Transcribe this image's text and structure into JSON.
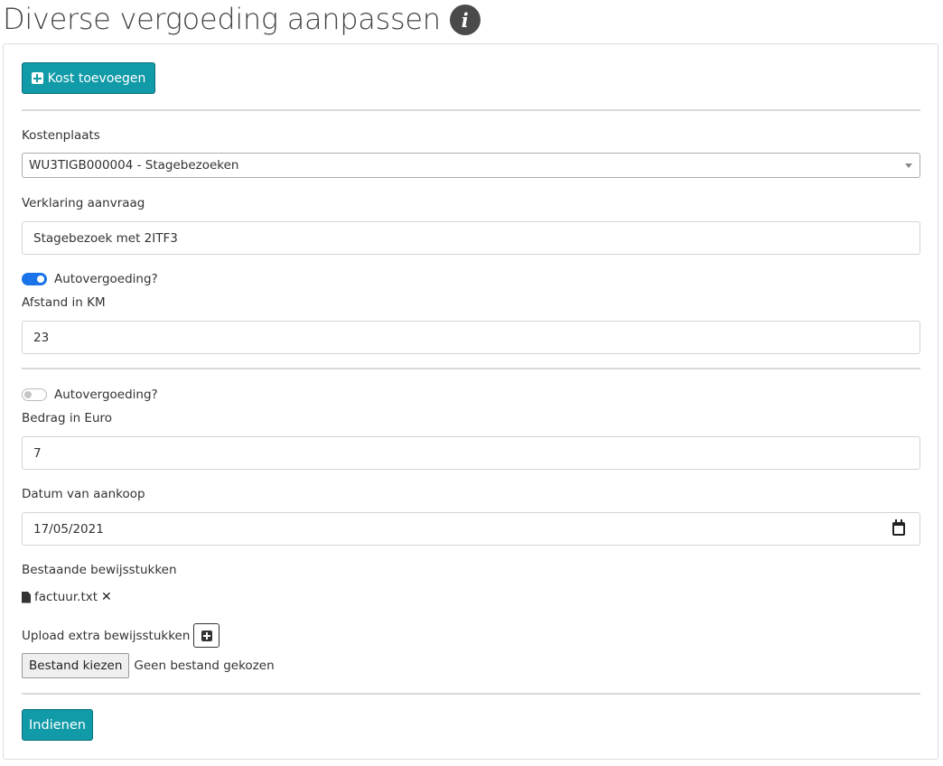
{
  "page": {
    "title": "Diverse vergoeding aanpassen",
    "info_icon": "info-circle-icon"
  },
  "form": {
    "add_cost_label": "Kost toevoegen",
    "cost_center": {
      "label": "Kostenplaats",
      "selected": "WU3TIGB000004 - Stagebezoeken"
    },
    "statement": {
      "label": "Verklaring aanvraag",
      "value": "Stagebezoek met 2ITF3"
    },
    "entries": [
      {
        "car_toggle_label": "Autovergoeding?",
        "car_toggle_on": true,
        "field_label": "Afstand in KM",
        "field_value": "23"
      },
      {
        "car_toggle_label": "Autovergoeding?",
        "car_toggle_on": false,
        "field_label": "Bedrag in Euro",
        "field_value": "7",
        "date_label": "Datum van aankoop",
        "date_value": "17/05/2021",
        "existing_label": "Bestaande bewijsstukken",
        "existing_files": [
          "factuur.txt"
        ],
        "upload_label": "Upload extra bewijsstukken",
        "choose_file_label": "Bestand kiezen",
        "no_file_label": "Geen bestand gekozen"
      }
    ],
    "submit_label": "Indienen"
  },
  "colors": {
    "accent": "#119aa8",
    "toggle_on": "#1a73e8"
  }
}
